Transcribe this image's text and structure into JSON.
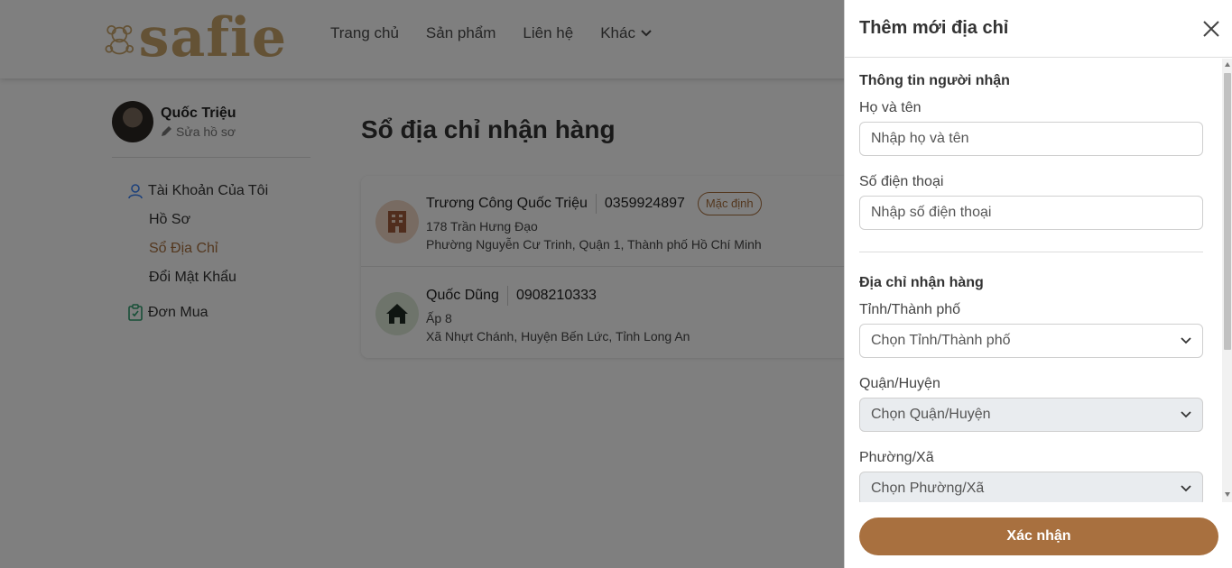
{
  "header": {
    "logo_text": "safie",
    "nav": [
      "Trang chủ",
      "Sản phẩm",
      "Liên hệ",
      "Khác"
    ]
  },
  "sidebar": {
    "user_name": "Quốc Triệu",
    "edit_profile": "Sửa hồ sơ",
    "account_label": "Tài Khoản Của Tôi",
    "items": [
      "Hồ Sơ",
      "Sổ Địa Chỉ",
      "Đổi Mật Khẩu"
    ],
    "orders_label": "Đơn Mua"
  },
  "main": {
    "title": "Sổ địa chỉ nhận hàng",
    "addresses": [
      {
        "name": "Trương Công Quốc Triệu",
        "phone": "0359924897",
        "badge": "Mặc định",
        "line1": "178 Trần Hưng Đạo",
        "line2": "Phường Nguyễn Cư Trinh, Quận 1, Thành phố Hồ Chí Minh",
        "icon": "building-icon"
      },
      {
        "name": "Quốc Dũng",
        "phone": "0908210333",
        "line1": "Ấp 8",
        "line2": "Xã Nhựt Chánh, Huyện Bến Lức, Tỉnh Long An",
        "icon": "house-icon"
      }
    ]
  },
  "drawer": {
    "title": "Thêm mới địa chỉ",
    "recipient_section": "Thông tin người nhận",
    "name_label": "Họ và tên",
    "name_placeholder": "Nhập họ và tên",
    "phone_label": "Số điện thoại",
    "phone_placeholder": "Nhập số điện thoại",
    "address_section": "Địa chỉ nhận hàng",
    "province_label": "Tỉnh/Thành phố",
    "province_value": "Chọn Tỉnh/Thành phố",
    "district_label": "Quận/Huyện",
    "district_value": "Chọn Quận/Huyện",
    "ward_label": "Phường/Xã",
    "ward_value": "Chọn Phường/Xã",
    "confirm": "Xác nhận"
  },
  "colors": {
    "accent": "#a8703f",
    "logo": "#c9a46b",
    "overlay": "rgba(0,0,0,0.5)"
  }
}
